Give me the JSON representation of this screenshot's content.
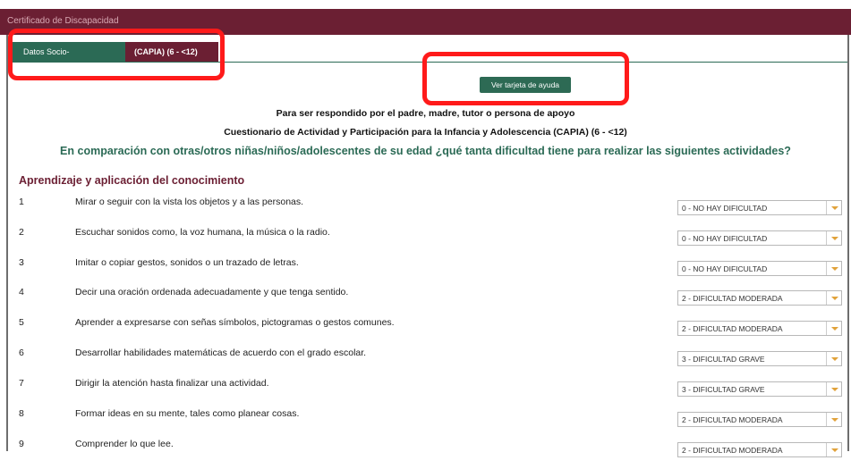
{
  "window": {
    "title": "Certificado de Discapacidad"
  },
  "tabs": [
    {
      "label": "Datos Socio-demográficos"
    },
    {
      "label": "(CAPIA) (6 - <12)"
    }
  ],
  "help_button": {
    "label": "Ver tarjeta de ayuda"
  },
  "intro": {
    "respondent": "Para ser respondido por el padre, madre, tutor o persona de apoyo",
    "questionnaire": "Cuestionario de Actividad y Participación para la Infancia y Adolescencia (CAPIA) (6 - <12)",
    "question": "En comparación con otras/otros niñas/niños/adolescentes de su edad ¿qué tanta dificultad tiene para realizar las siguientes actividades?"
  },
  "section": {
    "title": "Aprendizaje y aplicación del conocimiento"
  },
  "items": [
    {
      "num": "1",
      "text": "Mirar o seguir con la vista los objetos y a las personas.",
      "value": "0 - NO HAY DIFICULTAD"
    },
    {
      "num": "2",
      "text": "Escuchar sonidos como, la voz humana, la música o la radio.",
      "value": "0 - NO HAY DIFICULTAD"
    },
    {
      "num": "3",
      "text": "Imitar o copiar gestos, sonidos o un trazado de letras.",
      "value": "0 - NO HAY DIFICULTAD"
    },
    {
      "num": "4",
      "text": "Decir una oración ordenada adecuadamente y que tenga sentido.",
      "value": "2 - DIFICULTAD MODERADA"
    },
    {
      "num": "5",
      "text": "Aprender a expresarse con señas símbolos, pictogramas o gestos comunes.",
      "value": "2 - DIFICULTAD MODERADA"
    },
    {
      "num": "6",
      "text": "Desarrollar habilidades matemáticas de acuerdo con el grado escolar.",
      "value": "3 - DIFICULTAD GRAVE"
    },
    {
      "num": "7",
      "text": "Dirigir la atención hasta finalizar una actividad.",
      "value": "3 - DIFICULTAD GRAVE"
    },
    {
      "num": "8",
      "text": "Formar ideas en su mente, tales como planear cosas.",
      "value": "2 - DIFICULTAD MODERADA"
    },
    {
      "num": "9",
      "text": "Comprender lo que lee.",
      "value": "2 - DIFICULTAD MODERADA"
    }
  ],
  "colors": {
    "brand_maroon": "#6b1f33",
    "brand_green": "#2b6a55",
    "highlight_red": "#ff1a1a",
    "dropdown_arrow": "#e1a23a"
  }
}
